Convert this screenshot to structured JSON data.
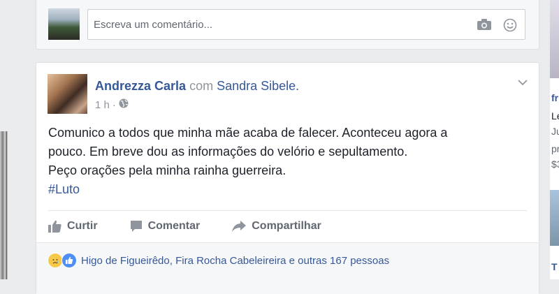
{
  "comment_box": {
    "placeholder": "Escreva um comentário..."
  },
  "post": {
    "author": "Andrezza Carla",
    "with_text": "com",
    "tagged": "Sandra Sibele.",
    "time": "1 h",
    "separator": "·",
    "body_lines": [
      "Comunico a todos que minha mãe acaba de falecer. Aconteceu agora a",
      "pouco. Em breve dou as informações do velório e sepultamento.",
      "Peço orações pela minha rainha guerreira."
    ],
    "hashtag": "#Luto"
  },
  "actions": {
    "like": "Curtir",
    "comment": "Comentar",
    "share": "Compartilhar"
  },
  "reactions": {
    "summary": "Higo de Figueirêdo, Fira Rocha Cabeleireira e outras 167 pessoas"
  },
  "right_column": {
    "fragments": [
      "fr",
      "Le",
      "Ju",
      "pr",
      "$3",
      "T"
    ]
  },
  "colors": {
    "link": "#365899",
    "muted": "#606770",
    "page_bg": "#e9ebee"
  }
}
